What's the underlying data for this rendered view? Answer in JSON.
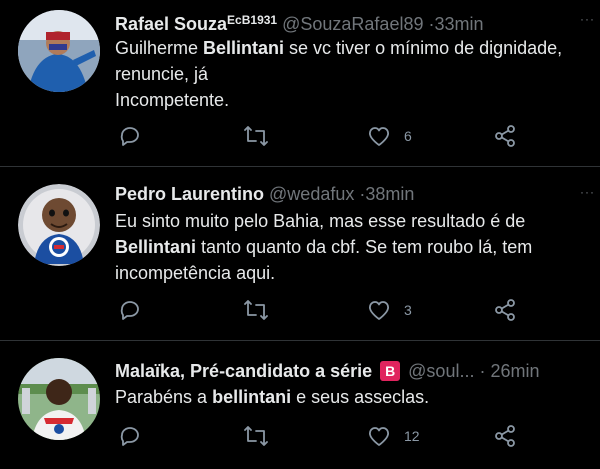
{
  "tweets": [
    {
      "name": "Rafael Souza",
      "name_suffix": "EcB1931",
      "handle": "@SouzaRafael89",
      "dot": "·",
      "time": "33min",
      "line1_pre": "Guilherme ",
      "line1_bold": "Bellintani",
      "line1_post": " se vc tiver o mínimo de dignidade,",
      "line2": "renuncie, já",
      "line3": "Incompetente.",
      "likes": "6"
    },
    {
      "name": "Pedro Laurentino",
      "handle": "@wedafux",
      "dot": "·",
      "time": "38min",
      "line1": "Eu sinto muito pelo Bahia, mas esse resultado é de",
      "line2_bold": "Bellintani",
      "line2_post": " tanto quanto da cbf. Se tem roubo lá, tem",
      "line3": "incompetência aqui.",
      "likes": "3"
    },
    {
      "name": "Malaïka, Pré-candidato a série",
      "badge": "B",
      "handle": "@soul...",
      "dot": "·",
      "time": "26min",
      "line1_pre": "Parabéns a ",
      "line1_bold": "bellintani",
      "line1_post": " e seus asseclas.",
      "likes": "12"
    }
  ],
  "more_label": "···",
  "icons": {
    "reply": "reply-icon",
    "retweet": "retweet-icon",
    "like": "heart-icon",
    "share": "share-icon",
    "more": "more-icon"
  },
  "colors": {
    "background": "#000000",
    "text": "#e7e9ea",
    "secondary": "#71767b",
    "icon": "#8b98a5",
    "separator": "#2f3336",
    "badge": "#e0245e"
  }
}
